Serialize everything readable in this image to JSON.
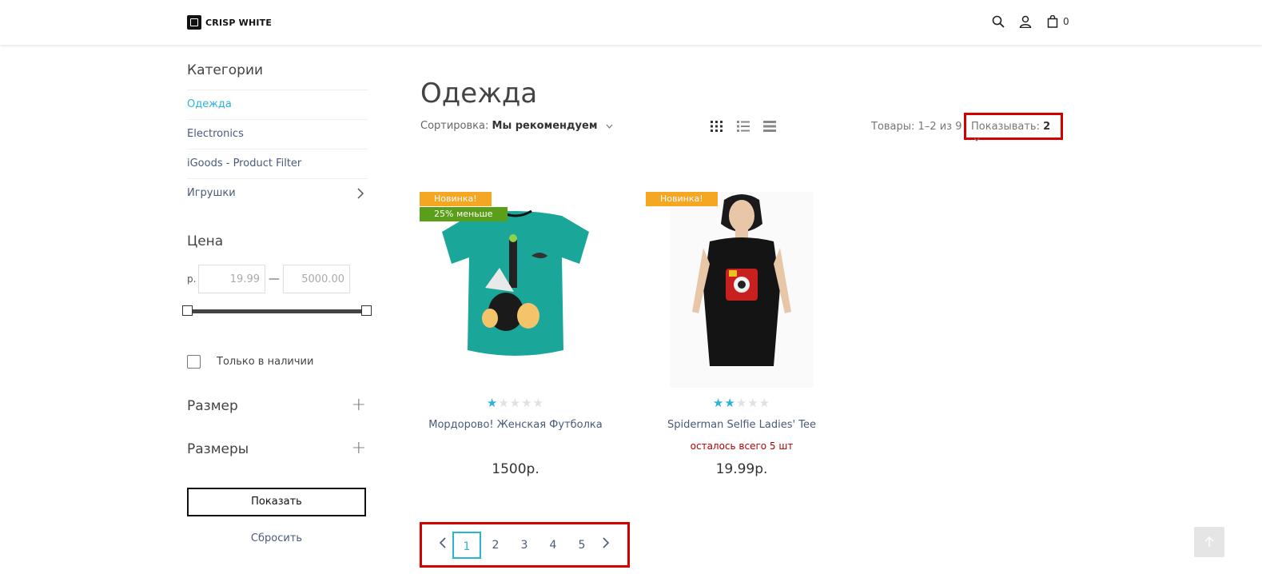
{
  "header": {
    "logo_text": "CRISP WHITE",
    "cart_count": "0",
    "icons": [
      "search-icon",
      "user-icon",
      "cart-icon"
    ]
  },
  "sidebar": {
    "categories_title": "Категории",
    "categories": [
      {
        "label": "Одежда",
        "active": true
      },
      {
        "label": "Electronics",
        "active": false
      },
      {
        "label": "iGoods - Product Filter",
        "active": false
      },
      {
        "label": "Игрушки",
        "active": false,
        "has_children": true
      }
    ],
    "price": {
      "title": "Цена",
      "currency": "р.",
      "min": "19.99",
      "max": "5000.00"
    },
    "in_stock_label": "Только в наличии",
    "facets": [
      "Размер",
      "Размеры"
    ],
    "show_button": "Показать",
    "reset_link": "Сбросить"
  },
  "main": {
    "title": "Одежда",
    "sort_label": "Сортировка:",
    "sort_value": "Мы рекомендуем",
    "count_text": "Товары: 1–2 из 9",
    "per_page_label": "Показывать:",
    "per_page_value": "2",
    "products": [
      {
        "badges": [
          "Новинка!",
          "25% меньше"
        ],
        "rating": 1.5,
        "name": "Мордорово! Женская Футболка",
        "stock": "",
        "price": "1500р."
      },
      {
        "badges": [
          "Новинка!"
        ],
        "rating": 2,
        "name": "Spiderman Selfie Ladies' Tee",
        "stock": "осталось всего 5 шт",
        "price": "19.99р."
      }
    ],
    "pagination": {
      "pages": [
        "1",
        "2",
        "3",
        "4",
        "5"
      ],
      "current": "1",
      "prev": "‹",
      "next": "›"
    }
  },
  "colors": {
    "accent": "#2ab4d4",
    "badge_new": "#f5a623",
    "badge_sale": "#5a9e1a",
    "highlight": "#d40000"
  }
}
